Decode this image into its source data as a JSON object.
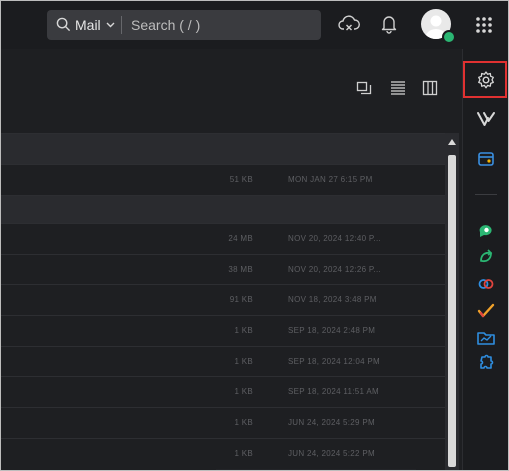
{
  "search": {
    "scope": "Mail",
    "placeholder": "Search ( / )"
  },
  "toolbar_icons": [
    "cloud-sync-icon",
    "bell-icon",
    "avatar",
    "app-grid-icon"
  ],
  "view_icons": [
    "split-view-icon",
    "list-view-icon",
    "column-view-icon"
  ],
  "rail_icons": [
    "gear-icon",
    "vani-icon",
    "bookings-icon",
    "cliq-icon",
    "refresh-icon",
    "link-icon",
    "check-icon",
    "folder-chart-icon",
    "puzzle-icon"
  ],
  "rows": [
    {
      "kind": "group"
    },
    {
      "kind": "item",
      "size": "51 KB",
      "date": "MON JAN 27 6:15 PM"
    },
    {
      "kind": "group"
    },
    {
      "kind": "item",
      "size": "24 MB",
      "date": "NOV 20, 2024 12:40 P..."
    },
    {
      "kind": "item",
      "size": "38 MB",
      "date": "NOV 20, 2024 12:26 P..."
    },
    {
      "kind": "item",
      "size": "91 KB",
      "date": "NOV 18, 2024 3:48 PM"
    },
    {
      "kind": "item",
      "size": "1 KB",
      "date": "SEP 18, 2024 2:48 PM"
    },
    {
      "kind": "item",
      "size": "1 KB",
      "date": "SEP 18, 2024 12:04 PM"
    },
    {
      "kind": "item",
      "size": "1 KB",
      "date": "SEP 18, 2024 11:51 AM"
    },
    {
      "kind": "item",
      "size": "1 KB",
      "date": "JUN 24, 2024 5:29 PM"
    },
    {
      "kind": "item",
      "size": "1 KB",
      "date": "JUN 24, 2024 5:22 PM"
    }
  ],
  "colors": {
    "accent_highlight": "#e03131",
    "status_online": "#2bb673",
    "rail_green": "#2bb673",
    "rail_blue": "#2f8ee0"
  }
}
